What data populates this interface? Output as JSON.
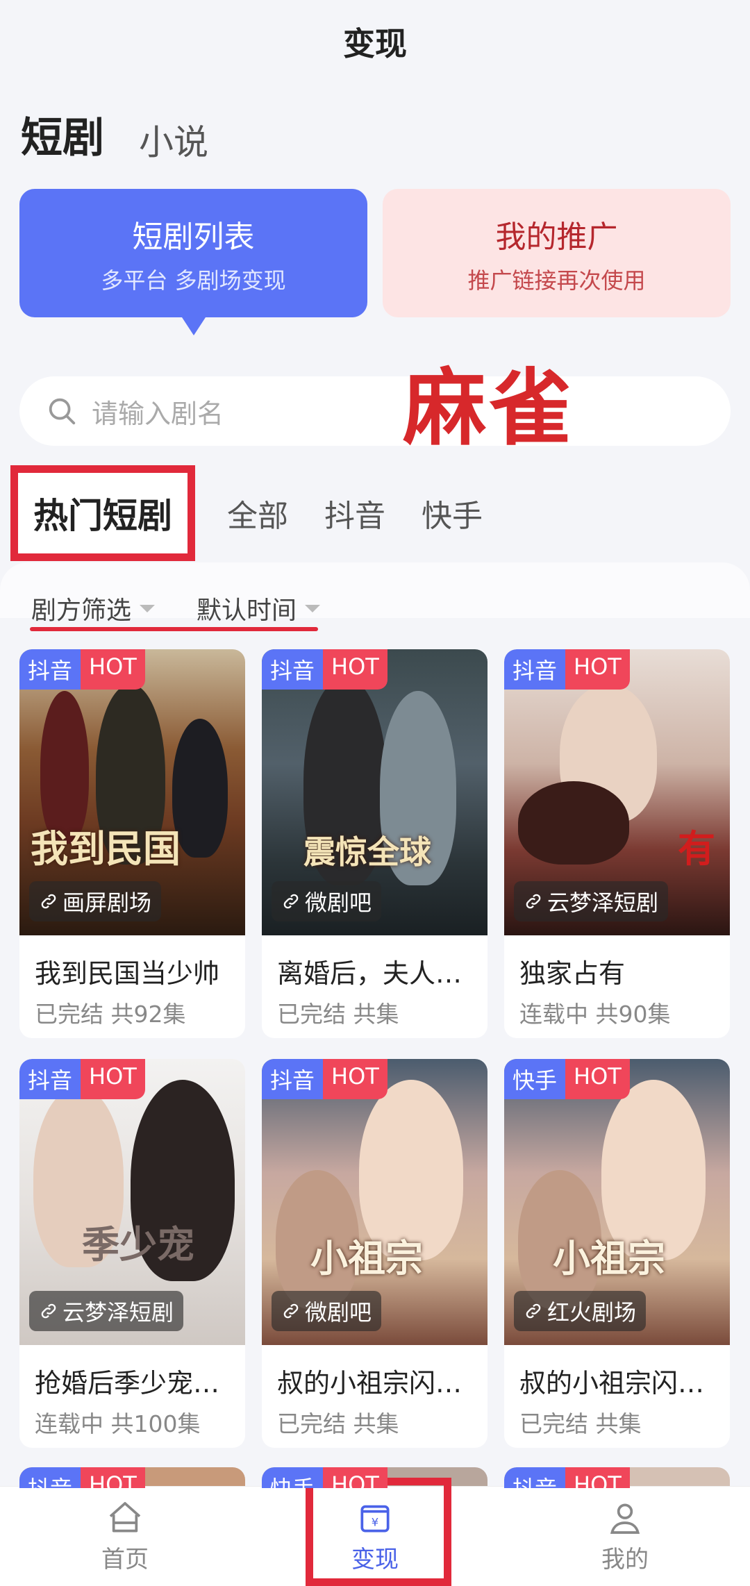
{
  "header": {
    "title": "变现"
  },
  "main_tabs": [
    {
      "label": "短剧",
      "active": true
    },
    {
      "label": "小说",
      "active": false
    }
  ],
  "promo_cards": [
    {
      "title": "短剧列表",
      "subtitle": "多平台 多剧场变现",
      "color": "#5b74f6"
    },
    {
      "title": "我的推广",
      "subtitle": "推广链接再次使用",
      "color": "#fde4e4"
    }
  ],
  "search": {
    "placeholder": "请输入剧名",
    "icon": "search-icon"
  },
  "watermark": "麻雀",
  "category_tabs": [
    {
      "label": "热门短剧",
      "active": true
    },
    {
      "label": "全部",
      "active": false
    },
    {
      "label": "抖音",
      "active": false
    },
    {
      "label": "快手",
      "active": false
    }
  ],
  "filters": [
    {
      "label": "剧方筛选"
    },
    {
      "label": "默认时间"
    }
  ],
  "dramas": [
    {
      "platform": "抖音",
      "hot": "HOT",
      "source": "画屏剧场",
      "name": "我到民国当少帅",
      "status": "已完结 共92集",
      "poster_text": "我到民国"
    },
    {
      "platform": "抖音",
      "hot": "HOT",
      "source": "微剧吧",
      "name": "离婚后，夫人…",
      "status": "已完结 共集",
      "poster_text": "震惊全球"
    },
    {
      "platform": "抖音",
      "hot": "HOT",
      "source": "云梦泽短剧",
      "name": "独家占有",
      "status": "连载中 共90集",
      "poster_text": "有"
    },
    {
      "platform": "抖音",
      "hot": "HOT",
      "source": "云梦泽短剧",
      "name": "抢婚后季少宠…",
      "status": "连载中 共100集",
      "poster_text": "季少宠"
    },
    {
      "platform": "抖音",
      "hot": "HOT",
      "source": "微剧吧",
      "name": "叔的小祖宗闪…",
      "status": "已完结 共集",
      "poster_text": "小祖宗"
    },
    {
      "platform": "快手",
      "hot": "HOT",
      "source": "红火剧场",
      "name": "叔的小祖宗闪…",
      "status": "已完结 共集",
      "poster_text": "小祖宗"
    }
  ],
  "next_row_platforms": [
    "抖音",
    "快手",
    "抖音"
  ],
  "bottom_nav": [
    {
      "label": "首页",
      "icon": "home-icon",
      "active": false
    },
    {
      "label": "变现",
      "icon": "wallet-icon",
      "active": true
    },
    {
      "label": "我的",
      "icon": "user-icon",
      "active": false
    }
  ],
  "colors": {
    "accent": "#5b74f6",
    "highlight": "#e1293b",
    "hot": "#f0465a"
  }
}
